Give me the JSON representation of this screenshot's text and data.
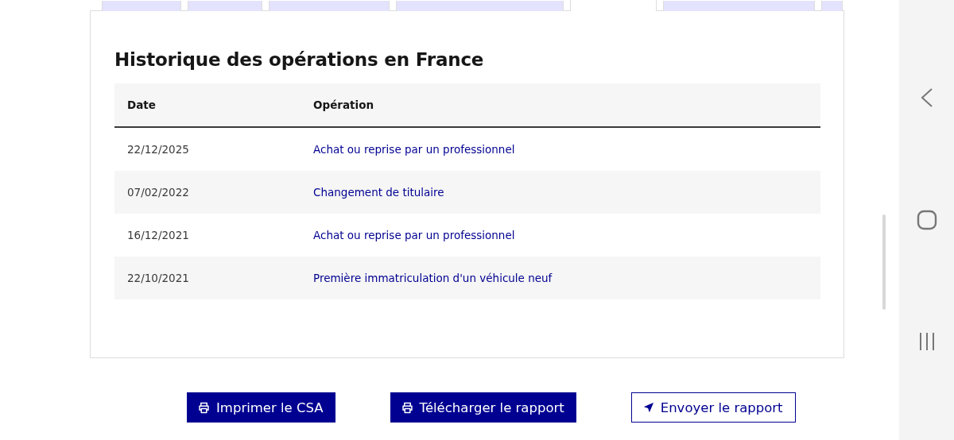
{
  "tabs": [
    {
      "selected": false
    },
    {
      "selected": false
    },
    {
      "selected": false
    },
    {
      "selected": false
    },
    {
      "selected": true
    },
    {
      "selected": false
    },
    {
      "selected": false
    }
  ],
  "title": "Historique des opérations en France",
  "table": {
    "columns": [
      "Date",
      "Opération"
    ],
    "rows": [
      {
        "date": "22/12/2025",
        "operation": "Achat ou reprise par un professionnel"
      },
      {
        "date": "07/02/2022",
        "operation": "Changement de titulaire"
      },
      {
        "date": "16/12/2021",
        "operation": "Achat ou reprise par un professionnel"
      },
      {
        "date": "22/10/2021",
        "operation": "Première immatriculation d'un véhicule neuf"
      }
    ]
  },
  "buttons": [
    {
      "kind": "print",
      "label": "Imprimer le CSA",
      "primary": true
    },
    {
      "kind": "print",
      "label": "Télécharger le rapport",
      "primary": true
    },
    {
      "kind": "send",
      "label": "Envoyer le rapport",
      "primary": false
    }
  ]
}
